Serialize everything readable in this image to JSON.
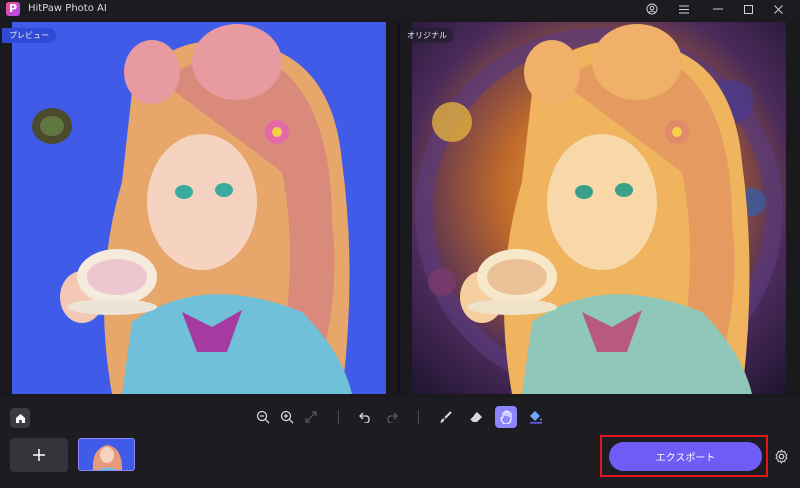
{
  "app": {
    "title": "HitPaw Photo AI",
    "logo_icon": "hitpaw-logo-icon"
  },
  "window_controls": {
    "account_icon": "account-icon",
    "menu_icon": "menu-icon",
    "minimize_icon": "minimize-icon",
    "maximize_icon": "maximize-icon",
    "close_icon": "close-icon"
  },
  "preview": {
    "left_label": "プレビュー",
    "right_label": "オリジナル",
    "left_background": "#3f5be8"
  },
  "toolbar": {
    "home_icon": "home-icon",
    "zoom_out_icon": "zoom-out-icon",
    "zoom_in_icon": "zoom-in-icon",
    "fit_icon": "fit-screen-icon",
    "undo_icon": "undo-icon",
    "redo_icon": "redo-icon",
    "brush_icon": "brush-icon",
    "eraser_icon": "eraser-icon",
    "hand_icon": "hand-icon",
    "fill_icon": "fill-bucket-icon",
    "active_tool": "hand"
  },
  "bottom": {
    "add_icon": "plus-icon",
    "export_label": "エクスポート",
    "settings_icon": "gear-icon"
  },
  "colors": {
    "accent": "#6f5cf6",
    "highlight": "#e0161b",
    "active_tool": "#8d84ff"
  }
}
